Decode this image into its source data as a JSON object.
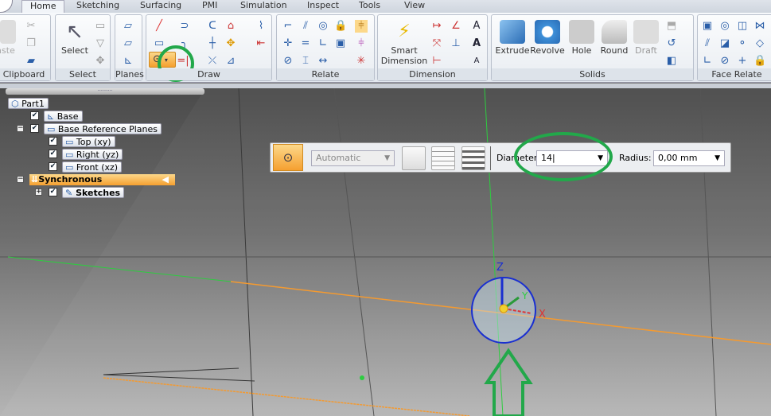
{
  "tabs": [
    "Home",
    "Sketching",
    "Surfacing",
    "PMI",
    "Simulation",
    "Inspect",
    "Tools",
    "View"
  ],
  "active_tab": "Home",
  "ribbon": {
    "clipboard": {
      "label": "Clipboard",
      "paste": "Paste"
    },
    "select": {
      "label": "Select",
      "button": "Select"
    },
    "planes": {
      "label": "Planes"
    },
    "draw": {
      "label": "Draw",
      "active_tool": "circle-by-center"
    },
    "relate": {
      "label": "Relate"
    },
    "dimension": {
      "label": "Dimension",
      "smart_dimension": "Smart Dimension"
    },
    "solids": {
      "label": "Solids",
      "extrude": "Extrude",
      "revolve": "Revolve",
      "hole": "Hole",
      "round": "Round",
      "draft": "Draft"
    },
    "face_relate": {
      "label": "Face Relate"
    }
  },
  "tree": {
    "root": "Part1",
    "items": [
      {
        "label": "Base",
        "checked": true
      },
      {
        "label": "Base Reference Planes",
        "checked": true,
        "expanded": true
      },
      {
        "label": "Top (xy)",
        "checked": true
      },
      {
        "label": "Right (yz)",
        "checked": true
      },
      {
        "label": "Front (xz)",
        "checked": true
      },
      {
        "label": "Synchronous",
        "expanded": true
      },
      {
        "label": "Sketches",
        "checked": true,
        "expanded": false
      }
    ]
  },
  "command_bar": {
    "style": "Automatic",
    "diameter_label": "Diameter:",
    "diameter_value": "14",
    "radius_label": "Radius:",
    "radius_value": "0,00 mm"
  },
  "triad": {
    "x": "X",
    "y": "Y",
    "z": "Z"
  },
  "colors": {
    "accent": "#f5a030",
    "annotation": "#22a84a",
    "circle": "#1a2fd0",
    "axis_x": "#f49a30",
    "axis_z": "#2ecc40"
  }
}
